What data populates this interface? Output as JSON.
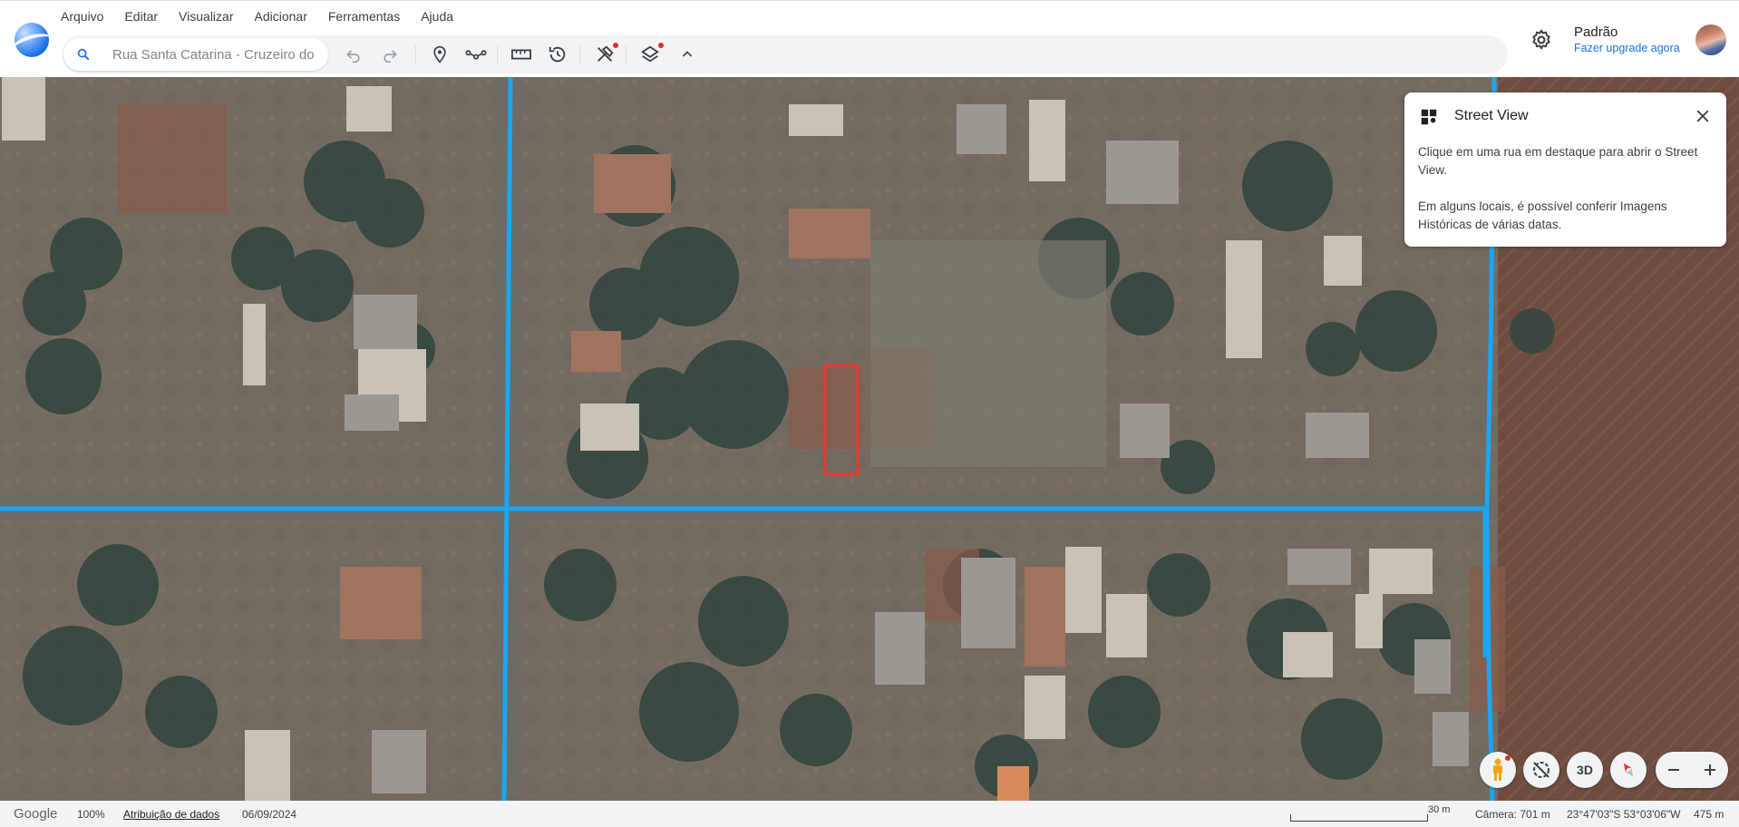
{
  "menu": [
    "Arquivo",
    "Editar",
    "Visualizar",
    "Adicionar",
    "Ferramentas",
    "Ajuda"
  ],
  "search": {
    "value": "Rua Santa Catarina - Cruzeiro do"
  },
  "toolbar": {
    "icons": [
      "undo-icon",
      "redo-icon",
      "placemark-icon",
      "path-icon",
      "ruler-icon",
      "historical-imagery-icon",
      "tools-icon",
      "layers-icon",
      "collapse-icon"
    ]
  },
  "account": {
    "name": "Padrão",
    "upgrade": "Fazer upgrade agora"
  },
  "street_view": {
    "title": "Street View",
    "line1": "Clique em uma rua em destaque para abrir o Street View.",
    "line2": "Em alguns locais, é possível conferir Imagens Históricas de várias datas."
  },
  "controls": {
    "view3d": "3D"
  },
  "status": {
    "brand": "Google",
    "zoom": "100%",
    "attribution": "Atribuição de dados",
    "date": "06/09/2024",
    "scale": "30 m",
    "camera": "Câmera: 701 m",
    "coords": "23°47'03\"S 53°03'06\"W",
    "elevation": "475 m"
  },
  "colors": {
    "street_overlay": "#1aa6f0",
    "selection": "#e53935",
    "link": "#1a73e8"
  }
}
